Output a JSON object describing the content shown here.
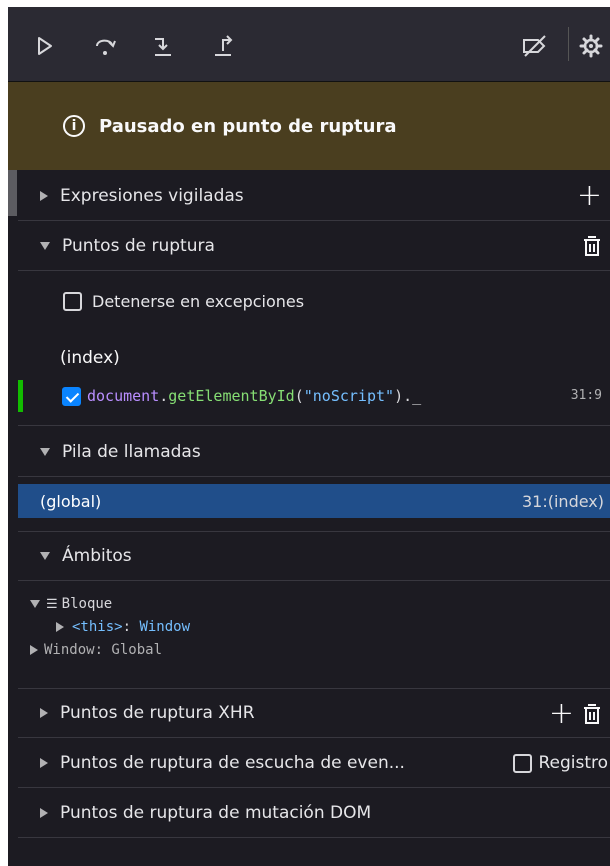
{
  "toolbar": {
    "icons": [
      "resume-icon",
      "step-over-icon",
      "step-in-icon",
      "step-out-icon",
      "deactivate-breakpoints-icon",
      "settings-icon"
    ]
  },
  "banner": {
    "text": "Pausado en punto de ruptura",
    "color": "#4a3e1f"
  },
  "sections": {
    "watch": {
      "title": "Expresiones vigiladas"
    },
    "breakpoints": {
      "title": "Puntos de ruptura",
      "pause_on_exceptions": "Detenerse en excepciones",
      "source": "(index)",
      "items": [
        {
          "obj": "document",
          "method": "getElementById",
          "arg": "\"noScript\"",
          "tail": ")._",
          "location": "31:9"
        }
      ]
    },
    "callstack": {
      "title": "Pila de llamadas",
      "frames": [
        {
          "name": "(global)",
          "location": "31:(index)"
        }
      ]
    },
    "scopes": {
      "title": "Ámbitos",
      "block_label": "Bloque",
      "this_name": "<this>",
      "this_value": "Window",
      "window_label": "Window: Global"
    },
    "xhr": {
      "title": "Puntos de ruptura XHR"
    },
    "events": {
      "title": "Puntos de ruptura de escucha de even...",
      "log_label": "Registro"
    },
    "dom": {
      "title": "Puntos de ruptura de mutación DOM"
    }
  },
  "colors": {
    "accent": "#0a84ff",
    "selected_frame": "#204e8a",
    "breakpoint_marker": "#12bc00",
    "code_method": "#86de74",
    "code_string": "#75bfff",
    "code_keyword": "#b98eff"
  }
}
